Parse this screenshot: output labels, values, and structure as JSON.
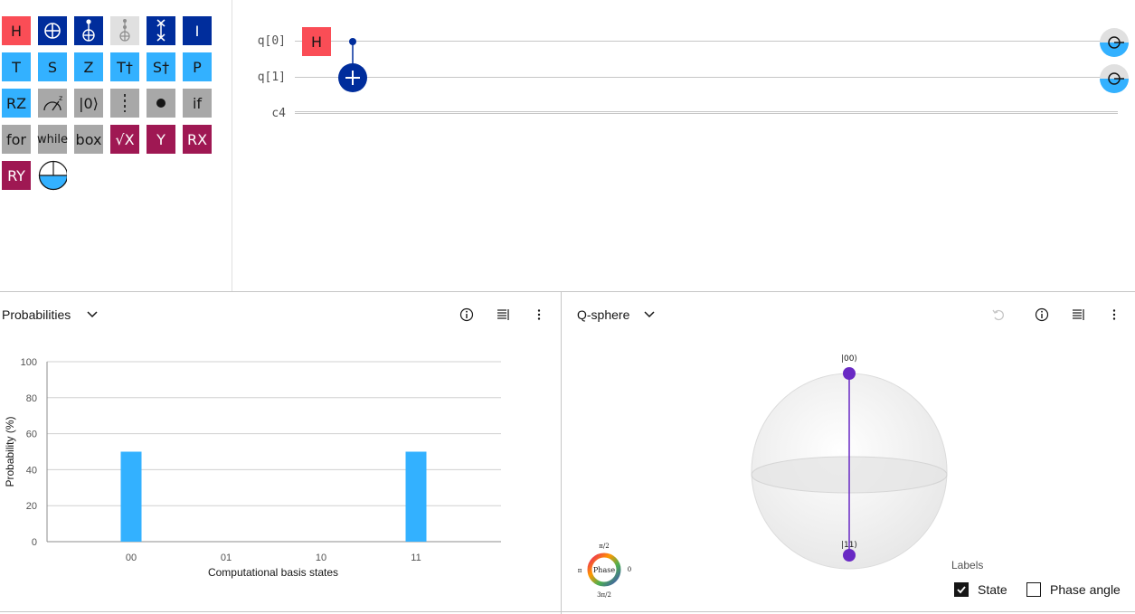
{
  "palette": {
    "gates": [
      {
        "label": "H",
        "color": "red"
      },
      {
        "label": "",
        "color": "navy",
        "icon": "cnot-target-icon"
      },
      {
        "label": "",
        "color": "navy",
        "icon": "controlled-not-icon"
      },
      {
        "label": "",
        "color": "light",
        "icon": "toffoli-icon"
      },
      {
        "label": "",
        "color": "navy",
        "icon": "swap-icon"
      },
      {
        "label": "I",
        "color": "navy"
      },
      {
        "label": "T",
        "color": "cyan"
      },
      {
        "label": "S",
        "color": "cyan"
      },
      {
        "label": "Z",
        "color": "cyan"
      },
      {
        "label": "T†",
        "color": "cyan"
      },
      {
        "label": "S†",
        "color": "cyan"
      },
      {
        "label": "P",
        "color": "cyan"
      },
      {
        "label": "RZ",
        "color": "cyan"
      },
      {
        "label": "",
        "color": "gray",
        "icon": "measure-z-icon"
      },
      {
        "label": "|0⟩",
        "color": "gray"
      },
      {
        "label": "",
        "color": "gray",
        "icon": "barrier-icon"
      },
      {
        "label": "",
        "color": "gray",
        "icon": "control-dot-icon"
      },
      {
        "label": "if",
        "color": "gray"
      },
      {
        "label": "for",
        "color": "gray"
      },
      {
        "label": "while",
        "color": "gray"
      },
      {
        "label": "box",
        "color": "gray"
      },
      {
        "label": "√X",
        "color": "magenta"
      },
      {
        "label": "Y",
        "color": "magenta"
      },
      {
        "label": "RX",
        "color": "magenta"
      },
      {
        "label": "RY",
        "color": "magenta"
      },
      {
        "label": "",
        "color": "circle",
        "icon": "measure-icon"
      }
    ]
  },
  "circuit": {
    "wires": [
      {
        "label": "q[0]"
      },
      {
        "label": "q[1]"
      },
      {
        "label": "c4"
      }
    ],
    "h_gate": "H"
  },
  "probabilities": {
    "title": "Probabilities",
    "chart_data": {
      "type": "bar",
      "categories": [
        "00",
        "01",
        "10",
        "11"
      ],
      "values": [
        50,
        0,
        0,
        50
      ],
      "xlabel": "Computational basis states",
      "ylabel": "Probability (%)",
      "ylim": [
        0,
        100
      ],
      "yticks": [
        0,
        20,
        40,
        60,
        80,
        100
      ],
      "grid": true,
      "bar_color": "#33b1ff"
    }
  },
  "qsphere": {
    "title": "Q-sphere",
    "state_top": "|00⟩",
    "state_bottom": "|11⟩",
    "phase_wheel": {
      "center": "Phase",
      "top": "π/2",
      "left": "π",
      "right": "0",
      "bottom": "3π/2"
    },
    "labels_title": "Labels",
    "state_checkbox": "State",
    "phase_checkbox": "Phase angle",
    "state_checked": true,
    "phase_checked": false,
    "point_color": "#6929c4"
  }
}
